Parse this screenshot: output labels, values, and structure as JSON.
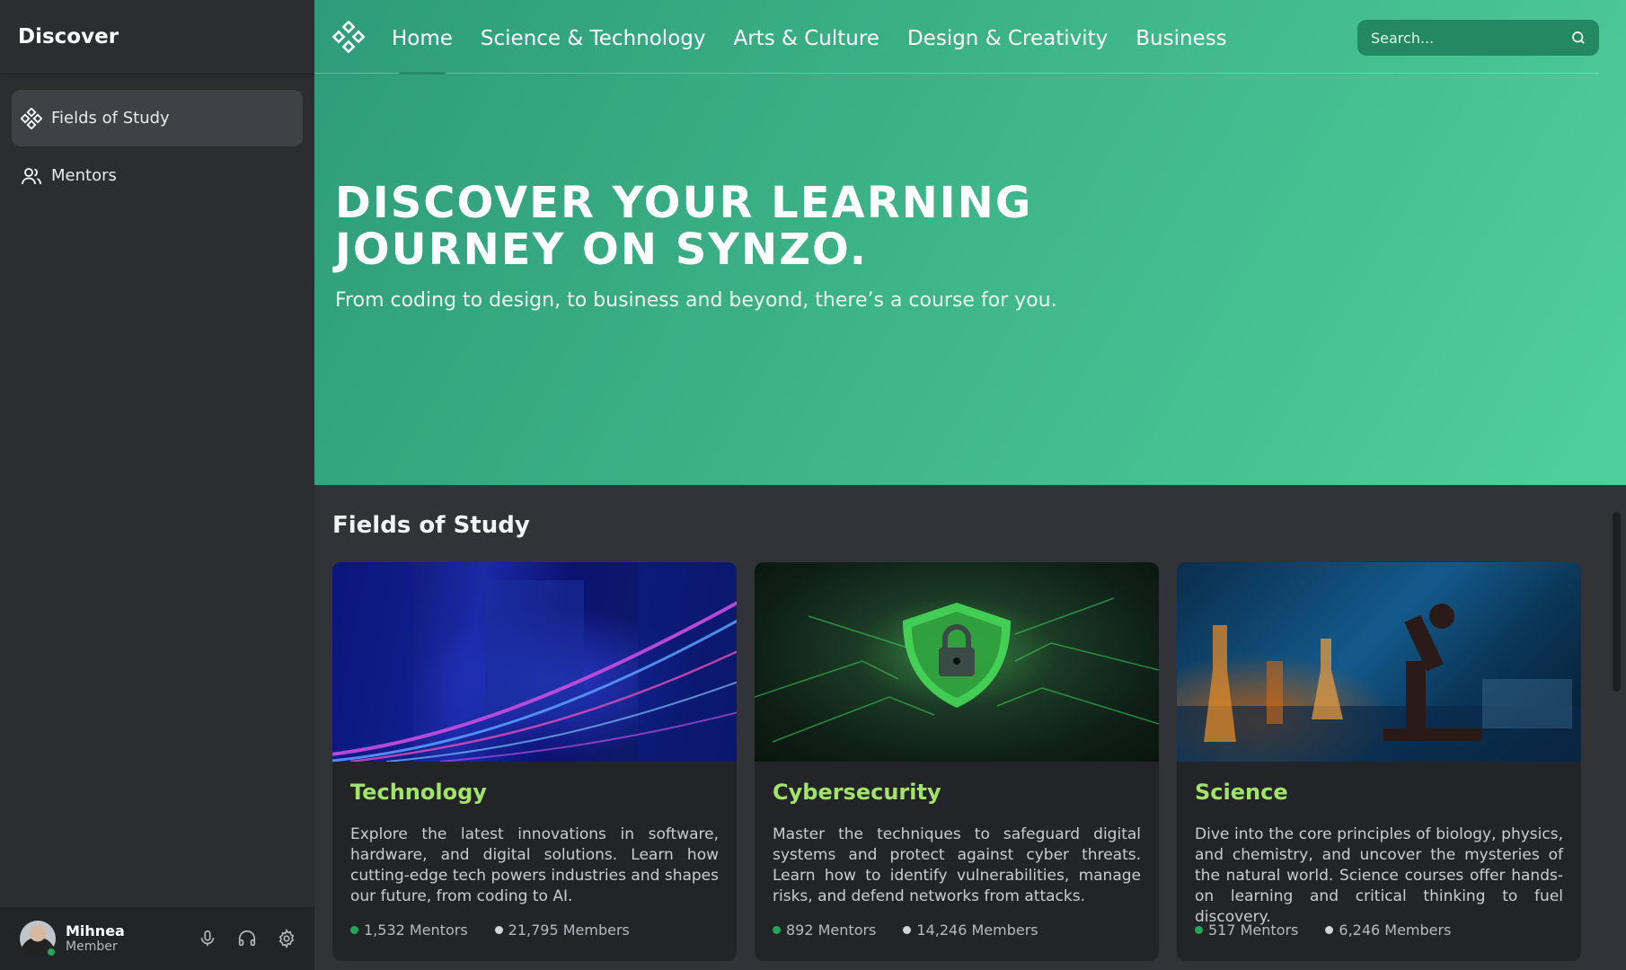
{
  "sidebar": {
    "title": "Discover",
    "items": [
      {
        "label": "Fields of Study",
        "icon": "diamond-cluster-icon",
        "active": true
      },
      {
        "label": "Mentors",
        "icon": "users-icon",
        "active": false
      }
    ],
    "user": {
      "name": "Mihnea",
      "role": "Member",
      "status": "online"
    }
  },
  "topnav": {
    "links": [
      {
        "label": "Home",
        "active": true
      },
      {
        "label": "Science & Technology",
        "active": false
      },
      {
        "label": "Arts & Culture",
        "active": false
      },
      {
        "label": "Design & Creativity",
        "active": false
      },
      {
        "label": "Business",
        "active": false
      }
    ],
    "search_placeholder": "Search..."
  },
  "hero": {
    "title": "DISCOVER YOUR LEARNING JOURNEY ON SYNZO.",
    "subtitle": "From coding to design, to business and beyond, there’s a course for you."
  },
  "section": {
    "title": "Fields of Study",
    "cards": [
      {
        "title": "Technology",
        "description": "Explore the latest innovations in software, hardware, and digital solutions. Learn how cutting-edge tech powers industries and shapes our future, from coding to AI.",
        "mentors": "1,532 Mentors",
        "members": "21,795 Members"
      },
      {
        "title": "Cybersecurity",
        "description": "Master the techniques to safeguard digital systems and protect against cyber threats. Learn how to identify vulnerabilities, manage risks, and defend networks from attacks.",
        "mentors": "892 Mentors",
        "members": "14,246 Members"
      },
      {
        "title": "Science",
        "description": "Dive into the core principles of biology, physics, and chemistry, and uncover the mysteries of the natural world. Science courses offer hands-on learning and critical thinking to fuel discovery.",
        "mentors": "517 Mentors",
        "members": "6,246 Members"
      }
    ]
  },
  "colors": {
    "accent_green": "#3db389",
    "card_title": "#a4e36a",
    "status_green": "#23a55a",
    "sidebar_bg": "#2b2d31",
    "main_bg": "#313338"
  }
}
